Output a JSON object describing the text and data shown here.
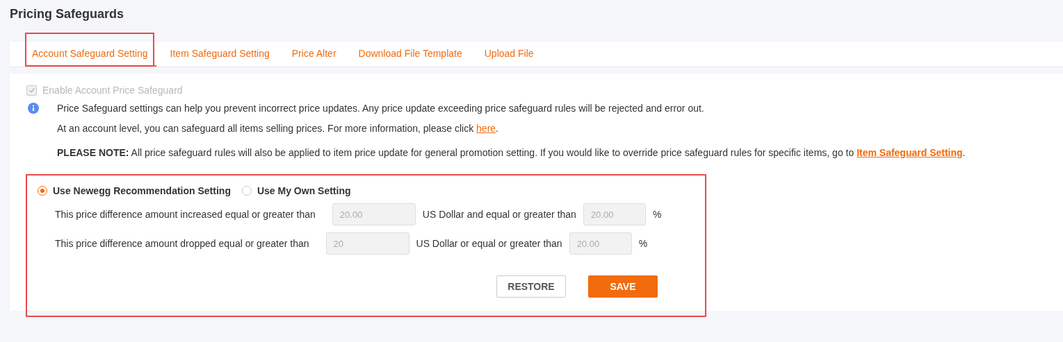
{
  "page_title": "Pricing Safeguards",
  "tabs": [
    {
      "label": "Account Safeguard Setting",
      "selected": true,
      "highlighted": true
    },
    {
      "label": "Item Safeguard Setting",
      "selected": false,
      "highlighted": false
    },
    {
      "label": "Price Alter",
      "selected": false,
      "highlighted": false
    },
    {
      "label": "Download File Template",
      "selected": false,
      "highlighted": false
    },
    {
      "label": "Upload File",
      "selected": false,
      "highlighted": false
    }
  ],
  "enable_checkbox": {
    "label": "Enable Account Price Safeguard",
    "checked": true,
    "disabled": true
  },
  "info_lines": [
    {
      "text": "Price Safeguard settings can help you prevent incorrect price updates. Any price update exceeding price safeguard rules will be rejected and error out."
    },
    {
      "text": "At an account level, you can safeguard all items selling prices. For more information, please click ",
      "link": "here",
      "after": "."
    }
  ],
  "note": {
    "text": "**PLEASE NOTE:** All price safeguard rules will also be applied to item price update for general promotion setting. If you would like to override price safeguard rules for specific items, go to ",
    "link": "Item Safeguard Setting",
    "after": "."
  },
  "settings_panel": {
    "highlighted": true,
    "options": [
      {
        "label": "Use Newegg Recommendation Setting",
        "selected": true
      },
      {
        "label": "Use My Own Setting",
        "selected": false
      }
    ],
    "rows": [
      {
        "label": "This price difference amount increased equal or greater than",
        "amount": "20.00",
        "unit": "US Dollar and equal or greater than",
        "percent": "20.00",
        "percent_sign": "%",
        "disabled": true
      },
      {
        "label": "This price difference amount dropped equal or greater than",
        "amount": "20",
        "unit": "US Dollar or equal or greater than",
        "percent": "20.00",
        "percent_sign": "%",
        "disabled": true
      }
    ],
    "buttons": [
      {
        "label": "RESTORE",
        "kind": "secondary"
      },
      {
        "label": "SAVE",
        "kind": "primary"
      }
    ]
  }
}
